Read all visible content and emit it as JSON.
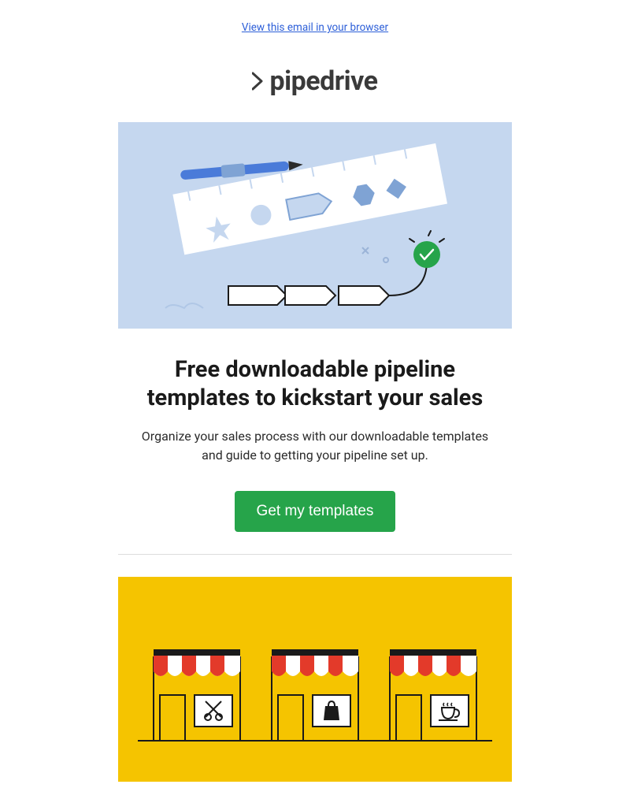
{
  "view_browser": "View this email in your browser",
  "brand": "pipedrive",
  "section1": {
    "headline": "Free downloadable pipeline templates to kickstart your sales",
    "subhead": "Organize your sales process with our downloadable templates and guide to getting your pipeline set up.",
    "cta_label": "Get my templates"
  },
  "colors": {
    "accent": "#26a44a",
    "link": "#2d5fd8",
    "hero1_bg": "#c5d7ef",
    "hero2_bg": "#f5c400"
  }
}
